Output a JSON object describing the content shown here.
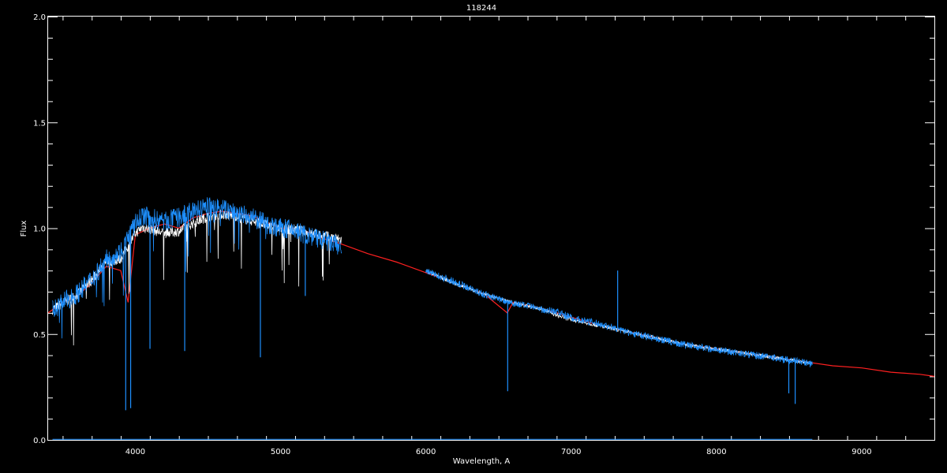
{
  "chart_data": {
    "type": "line",
    "title": "118244",
    "xlabel": "Wavelength, A",
    "ylabel": "Flux",
    "xlim": [
      3400,
      9500
    ],
    "ylim": [
      0.0,
      2.0
    ],
    "x_ticks": [
      4000,
      5000,
      6000,
      7000,
      8000,
      9000
    ],
    "x_tick_labels": [
      "4000",
      "5000",
      "6000",
      "7000",
      "8000",
      "9000"
    ],
    "y_ticks": [
      0.0,
      0.5,
      1.0,
      1.5,
      2.0
    ],
    "y_tick_labels": [
      "0.0",
      "0.5",
      "1.0",
      "1.5",
      "2.0"
    ],
    "grid": false,
    "series": [
      {
        "color": "#ff2020",
        "style": "model",
        "x": [
          3400,
          3500,
          3600,
          3700,
          3800,
          3900,
          3950,
          4000,
          4100,
          4200,
          4300,
          4400,
          4500,
          4600,
          4700,
          4800,
          4900,
          5000,
          5100,
          5200,
          5300,
          5400,
          5600,
          5800,
          6000,
          6200,
          6400,
          6560,
          6600,
          6800,
          7000,
          7200,
          7400,
          7600,
          7800,
          8000,
          8200,
          8400,
          8600,
          8800,
          9000,
          9200,
          9400,
          9500
        ],
        "y": [
          0.6,
          0.65,
          0.68,
          0.74,
          0.82,
          0.8,
          0.65,
          0.97,
          1.0,
          1.02,
          1.0,
          1.05,
          1.07,
          1.08,
          1.07,
          1.06,
          1.03,
          1.0,
          1.0,
          0.98,
          0.95,
          0.93,
          0.88,
          0.84,
          0.79,
          0.74,
          0.69,
          0.6,
          0.65,
          0.62,
          0.58,
          0.54,
          0.51,
          0.48,
          0.45,
          0.43,
          0.41,
          0.39,
          0.37,
          0.35,
          0.34,
          0.32,
          0.31,
          0.3
        ]
      },
      {
        "color": "#ffffff",
        "style": "observed",
        "x": [
          3430,
          3500,
          3600,
          3700,
          3800,
          3900,
          4000,
          4050,
          4100,
          4200,
          4300,
          4400,
          4500,
          4600,
          4700,
          4800,
          4900,
          5000,
          5100,
          5200,
          5300,
          5420,
          6000,
          6200,
          6400,
          6600,
          6800,
          6900,
          7000,
          7200,
          7400,
          7600,
          7800,
          8000,
          8200,
          8400,
          8600,
          8660
        ],
        "y": [
          0.62,
          0.65,
          0.69,
          0.76,
          0.84,
          0.86,
          0.98,
          1.01,
          1.0,
          0.98,
          0.99,
          1.03,
          1.06,
          1.07,
          1.06,
          1.04,
          1.02,
          1.0,
          1.0,
          0.98,
          0.97,
          0.95,
          0.8,
          0.74,
          0.69,
          0.65,
          0.62,
          0.59,
          0.57,
          0.54,
          0.51,
          0.48,
          0.45,
          0.43,
          0.41,
          0.39,
          0.37,
          0.36
        ]
      },
      {
        "color": "#1e90ff",
        "style": "observed",
        "x": [
          3430,
          3500,
          3600,
          3700,
          3800,
          3900,
          4000,
          4050,
          4100,
          4200,
          4300,
          4400,
          4500,
          4600,
          4700,
          4800,
          4900,
          5000,
          5100,
          5200,
          5300,
          5420,
          6000,
          6200,
          6400,
          6600,
          6800,
          6900,
          7000,
          7200,
          7400,
          7600,
          7800,
          8000,
          8200,
          8400,
          8600,
          8660
        ],
        "y": [
          0.62,
          0.66,
          0.7,
          0.77,
          0.86,
          0.9,
          1.03,
          1.07,
          1.06,
          1.04,
          1.06,
          1.09,
          1.11,
          1.1,
          1.08,
          1.06,
          1.03,
          1.01,
          1.0,
          0.97,
          0.95,
          0.92,
          0.8,
          0.75,
          0.69,
          0.65,
          0.62,
          0.61,
          0.58,
          0.55,
          0.51,
          0.48,
          0.45,
          0.43,
          0.41,
          0.39,
          0.37,
          0.36
        ]
      }
    ],
    "absorption_lines": [
      {
        "x": 3934,
        "depth_to": 0.14
      },
      {
        "x": 3968,
        "depth_to": 0.15
      },
      {
        "x": 4101,
        "depth_to": 0.43
      },
      {
        "x": 4340,
        "depth_to": 0.42
      },
      {
        "x": 4861,
        "depth_to": 0.39
      },
      {
        "x": 5170,
        "depth_to": 0.68
      },
      {
        "x": 6563,
        "depth_to": 0.23
      },
      {
        "x": 8498,
        "depth_to": 0.22
      },
      {
        "x": 8542,
        "depth_to": 0.17
      }
    ],
    "emission_spikes": [
      {
        "x": 7320,
        "peak": 0.8
      }
    ]
  }
}
